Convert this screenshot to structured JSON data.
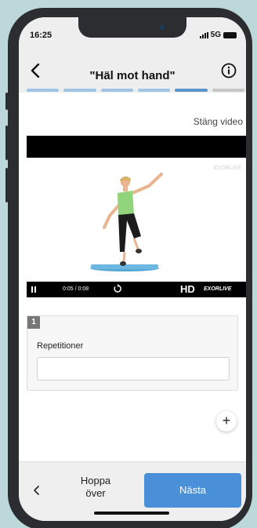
{
  "status": {
    "time": "16:25",
    "network": "5G"
  },
  "nav": {
    "title": "\"Häl mot hand\"",
    "back_icon": "chevron-left-icon",
    "info_icon": "info-circle-icon"
  },
  "progress": {
    "total_steps": 6,
    "current_step": 5
  },
  "video": {
    "close_label": "Stäng video",
    "elapsed": "0:05",
    "duration": "0:08",
    "quality": "HD",
    "brand": "EXORLIVE",
    "watermark": "EXORLIVE",
    "played_fraction": 0.62
  },
  "set": {
    "number": "1",
    "label": "Repetitioner",
    "value": ""
  },
  "bottom": {
    "skip_label_line1": "Hoppa",
    "skip_label_line2": "över",
    "next_label": "Nästa"
  },
  "colors": {
    "accent": "#4a90d9",
    "progress_done": "#9fc4e6",
    "progress_active": "#5b93cc",
    "progress_todo": "#c7c7c7"
  }
}
